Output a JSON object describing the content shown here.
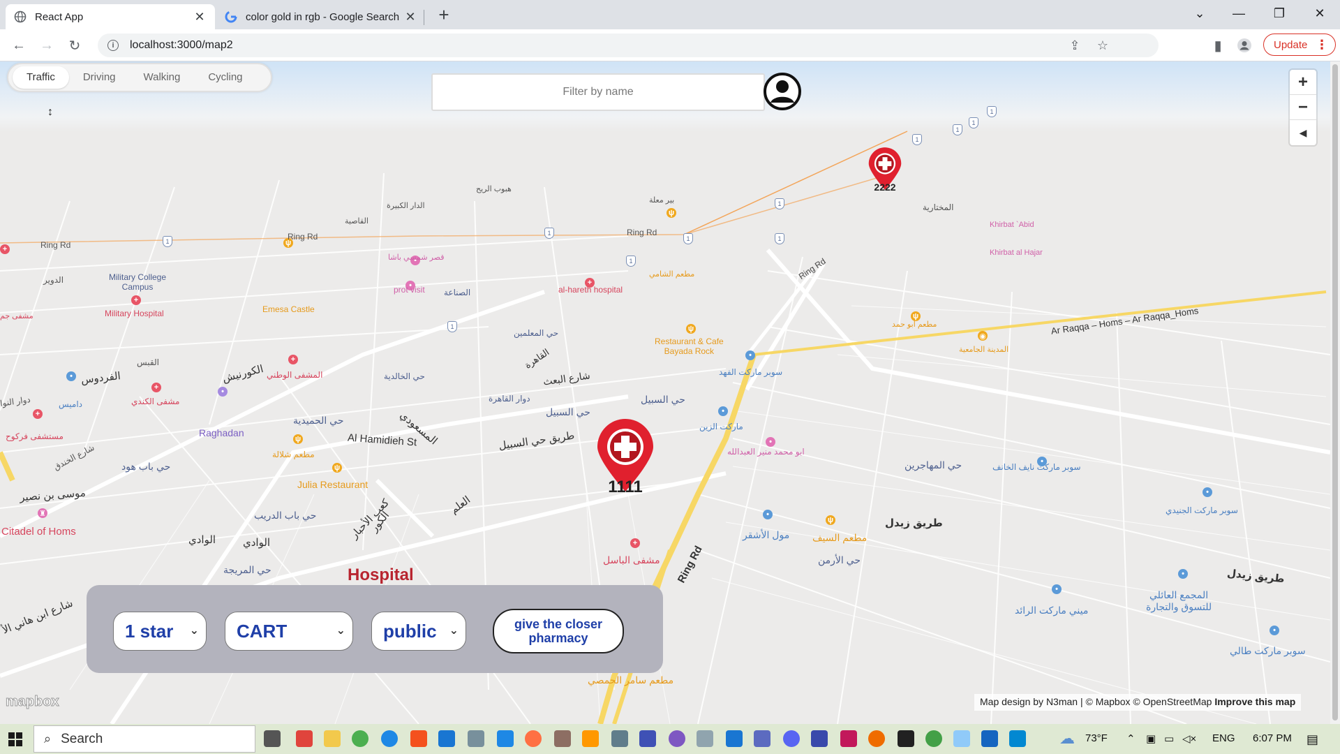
{
  "browser": {
    "tabs": [
      {
        "title": "React App",
        "active": true
      },
      {
        "title": "color gold in rgb - Google Search",
        "active": false
      }
    ],
    "url": "localhost:3000/map2",
    "update_label": "Update"
  },
  "map": {
    "modes": [
      "Traffic",
      "Driving",
      "Walking",
      "Cycling"
    ],
    "active_mode": "Traffic",
    "filter_placeholder": "Filter by name",
    "markers": [
      {
        "label": "1111"
      },
      {
        "label": "2222"
      }
    ],
    "hospital_label": "Hospital",
    "labels": {
      "ring_rd_1": "Ring Rd",
      "ring_rd_2": "Ring Rd",
      "ring_rd_3": "Ring Rd",
      "ring_rd_4": "Ring Rd",
      "military_college": "Military College\nCampus",
      "military_hospital": "Military Hospital",
      "emesa_castle": "Emesa Castle",
      "prot_visit": "prot visit",
      "al_hareth": "al-hareth hospital",
      "restaurant_cafe": "Restaurant & Cafe\nBayada Rock",
      "raghadan": "Raghadan",
      "al_hamidieh": "Al Hamidieh St",
      "julia": "Julia Restaurant",
      "citadel": "Citadel of Homs",
      "ar_raqqa": "Ar Raqqa – Homs – Ar Raqqa_Homs",
      "khirbat_abid": "Khirbat `Abid",
      "khirbat_hajar": "Khirbat al Hajar",
      "ring_rd_main": "Ring Rd",
      "a_dawar": "الدوير",
      "a_ferdaws": "الفردوس",
      "a_qubays": "القبس",
      "a_corniche": "الكورنيش",
      "a_wataniy": "المشفى الوطني",
      "a_kindi": "مشفى الكندي",
      "a_khalidiya": "حي الخالدية",
      "a_hamidiya": "حي الحميدية",
      "a_sabil": "حي السبيل",
      "a_tariq_sabil": "طريق حي السبيل",
      "a_zaidal": "طريق زيدل",
      "a_zaidal2": "طريق زيدل",
      "a_arman": "حي الأرمن",
      "a_muhajirin": "حي المهاجرين",
      "a_basil": "مشفى الباسل",
      "a_waadi": "الوادي",
      "a_waadi2": "الوادي",
      "a_muraija": "حي المريجة",
      "a_bab_hood": "حي باب هود",
      "a_bab_dreib": "حي باب الدريب",
      "a_musa": "موسى بن نصير",
      "a_khandaq": "شارع الخندق",
      "a_saif": "مطعم السيف",
      "a_ashqar": "مول الأشقر",
      "a_raed": "ميني ماركت الرائد",
      "a_mujamma": "المجمع العائلي\nللتسوق والتجارة",
      "a_talli": "سوبر ماركت طالي",
      "a_junaidi": "سوبر ماركت الجنيدي",
      "a_nayef": "سوبر ماركت نايف الخانف",
      "a_samer": "مطعم سامر الحمصي",
      "a_mukhtariya": "المختارية",
      "a_fahd": "سوبر ماركت الفهد",
      "a_zain": "ماركت الزين",
      "a_abu_mohammad": "ابو محمد منير العبدالله",
      "a_mukhtar_mosque": "المدينة الجامعية",
      "a_abu_hamad": "مطعم ابو حمد",
      "a_shami": "مطعم الشامي",
      "a_maalimeen": "حي المعلمين",
      "a_qahira": "القاهرة",
      "a_baath": "شارع البعث",
      "a_dawar_qahira": "دوار القاهرة",
      "a_sinaa": "الصناعة",
      "a_shamsi": "قصر شمسي باشا",
      "a_qasiya": "القاصية",
      "a_dar_kabira": "الدار الكبيرة",
      "a_hbub_rih": "هبوب الريح",
      "a_bir_maala": "بير معلة",
      "a_masoudi": "المسعودي",
      "a_kaab": "كعب الأحبار",
      "a_kawr": "الكور",
      "a_alam": "العلم",
      "a_ibn_hani": "شارع ابن هاني الأ",
      "a_shalala": "مطعم شلالة",
      "a_dawar_nawa": "دوار النوا",
      "a_damis": "داميس",
      "a_farkouh": "مستشفى فركوح",
      "a_mushfa_jam": "مشفى جم"
    }
  },
  "controls": {
    "rating": "1 star",
    "category": "CART",
    "type": "public",
    "closer_button": "give the closer\npharmacy"
  },
  "attribution": {
    "text": "Map design by N3man | © Mapbox © OpenStreetMap",
    "improve": "Improve this map",
    "logo": "mapbox"
  },
  "taskbar": {
    "search": "Search",
    "weather": "73°F",
    "lang": "ENG",
    "time": "6:07 PM"
  },
  "colors": {
    "select_text": "#1f3fa8",
    "marker_red": "#e0202e",
    "panel": "#b3b3bd",
    "update_red": "#d93025"
  }
}
